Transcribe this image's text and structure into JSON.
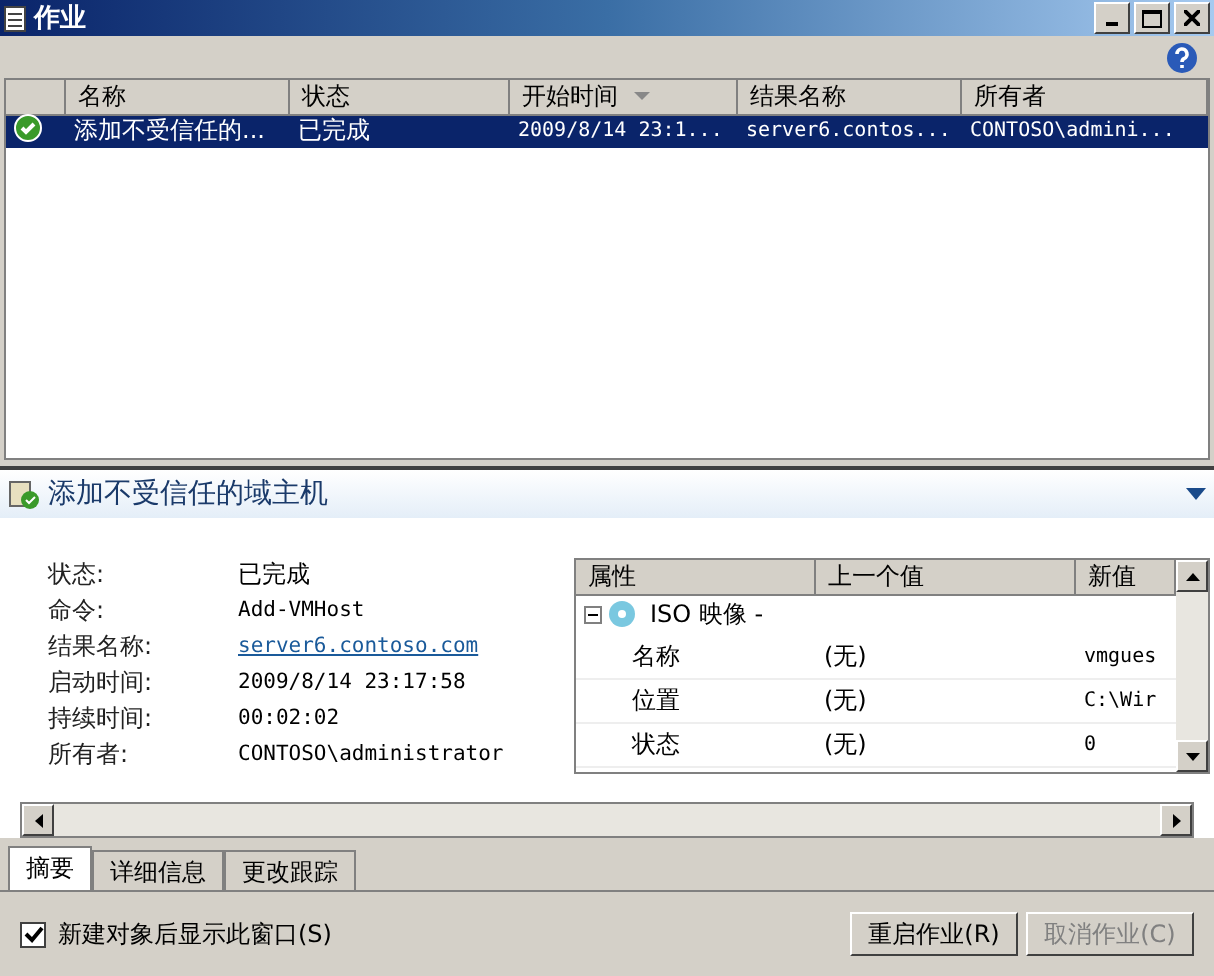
{
  "window": {
    "title": "作业"
  },
  "jobs_table": {
    "columns": [
      {
        "label": "名称",
        "sorted": false
      },
      {
        "label": "状态",
        "sorted": false
      },
      {
        "label": "开始时间",
        "sorted": true
      },
      {
        "label": "结果名称",
        "sorted": false
      },
      {
        "label": "所有者",
        "sorted": false
      }
    ],
    "rows": [
      {
        "selected": true,
        "cells": [
          "添加不受信任的...",
          "已完成",
          "2009/8/14 23:1...",
          "server6.contos...",
          "CONTOSO\\admini..."
        ]
      }
    ]
  },
  "detail": {
    "title": "添加不受信任的域主机",
    "expanded": true,
    "fields": [
      {
        "label": "状态:",
        "value": "已完成",
        "kind": "text"
      },
      {
        "label": "命令:",
        "value": "Add-VMHost",
        "kind": "mono"
      },
      {
        "label": "结果名称:",
        "value": "server6.contoso.com",
        "kind": "link"
      },
      {
        "label": "启动时间:",
        "value": "2009/8/14 23:17:58",
        "kind": "mono"
      },
      {
        "label": "持续时间:",
        "value": "00:02:02",
        "kind": "mono"
      },
      {
        "label": "所有者:",
        "value": "CONTOSO\\administrator",
        "kind": "mono"
      }
    ],
    "changes": {
      "columns": [
        "属性",
        "上一个值",
        "新值"
      ],
      "group": {
        "label": "ISO 映像 -",
        "expanded": true
      },
      "rows": [
        {
          "property": "名称",
          "previous": "(无)",
          "new": "vmgues"
        },
        {
          "property": "位置",
          "previous": "(无)",
          "new": "C:\\Wir"
        },
        {
          "property": "状态",
          "previous": "(无)",
          "new": "0"
        }
      ]
    }
  },
  "tabs": [
    {
      "label": "摘要",
      "selected": true
    },
    {
      "label": "详细信息",
      "selected": false
    },
    {
      "label": "更改跟踪",
      "selected": false
    }
  ],
  "footer": {
    "checkbox": {
      "label": "新建对象后显示此窗口(S)",
      "checked": true
    },
    "buttons": [
      {
        "label": "重启作业(R)",
        "disabled": false
      },
      {
        "label": "取消作业(C)",
        "disabled": true
      }
    ]
  }
}
